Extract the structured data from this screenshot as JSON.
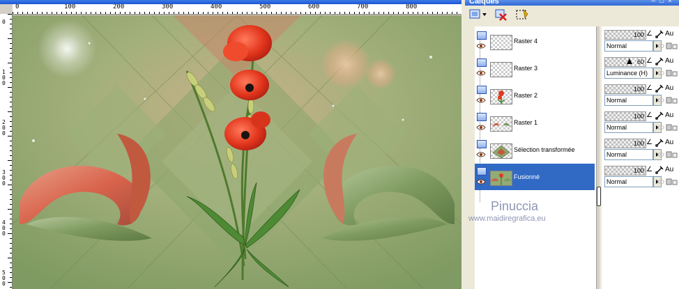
{
  "canvas": {
    "ruler_h_labels": [
      "0",
      "100",
      "200",
      "300",
      "400",
      "500",
      "600",
      "700",
      "800"
    ],
    "ruler_v_labels": [
      "0",
      "100",
      "200",
      "300",
      "400",
      "500"
    ]
  },
  "layers_panel": {
    "title": "Calques",
    "toolbar_icons": [
      "new-layer-icon",
      "delete-layer-icon",
      "mask-selection-icon"
    ],
    "layers": [
      {
        "name": "Raster 4",
        "opacity": 100,
        "blend_mode": "Normal",
        "au": "Au",
        "thumb": "transparent",
        "selected": false
      },
      {
        "name": "Raster 3",
        "opacity": 60,
        "blend_mode": "Luminance (H)",
        "au": "Au",
        "thumb": "transparent",
        "selected": false
      },
      {
        "name": "Raster 2",
        "opacity": 100,
        "blend_mode": "Normal",
        "au": "Au",
        "thumb": "flower",
        "selected": false
      },
      {
        "name": "Raster 1",
        "opacity": 100,
        "blend_mode": "Normal",
        "au": "Au",
        "thumb": "ribbons",
        "selected": false
      },
      {
        "name": "Sélection transformée",
        "opacity": 100,
        "blend_mode": "Normal",
        "au": "Au",
        "thumb": "diamond",
        "selected": false
      },
      {
        "name": "Fusionné",
        "opacity": 100,
        "blend_mode": "Normal",
        "au": "Au",
        "thumb": "full",
        "selected": true
      }
    ]
  },
  "watermark": {
    "name": "Pinuccia",
    "url": "www.maidiregrafica.eu"
  },
  "colors": {
    "selection": "#316ac5",
    "artwork_green": "#93ab74",
    "poppy_red": "#e03a22"
  }
}
